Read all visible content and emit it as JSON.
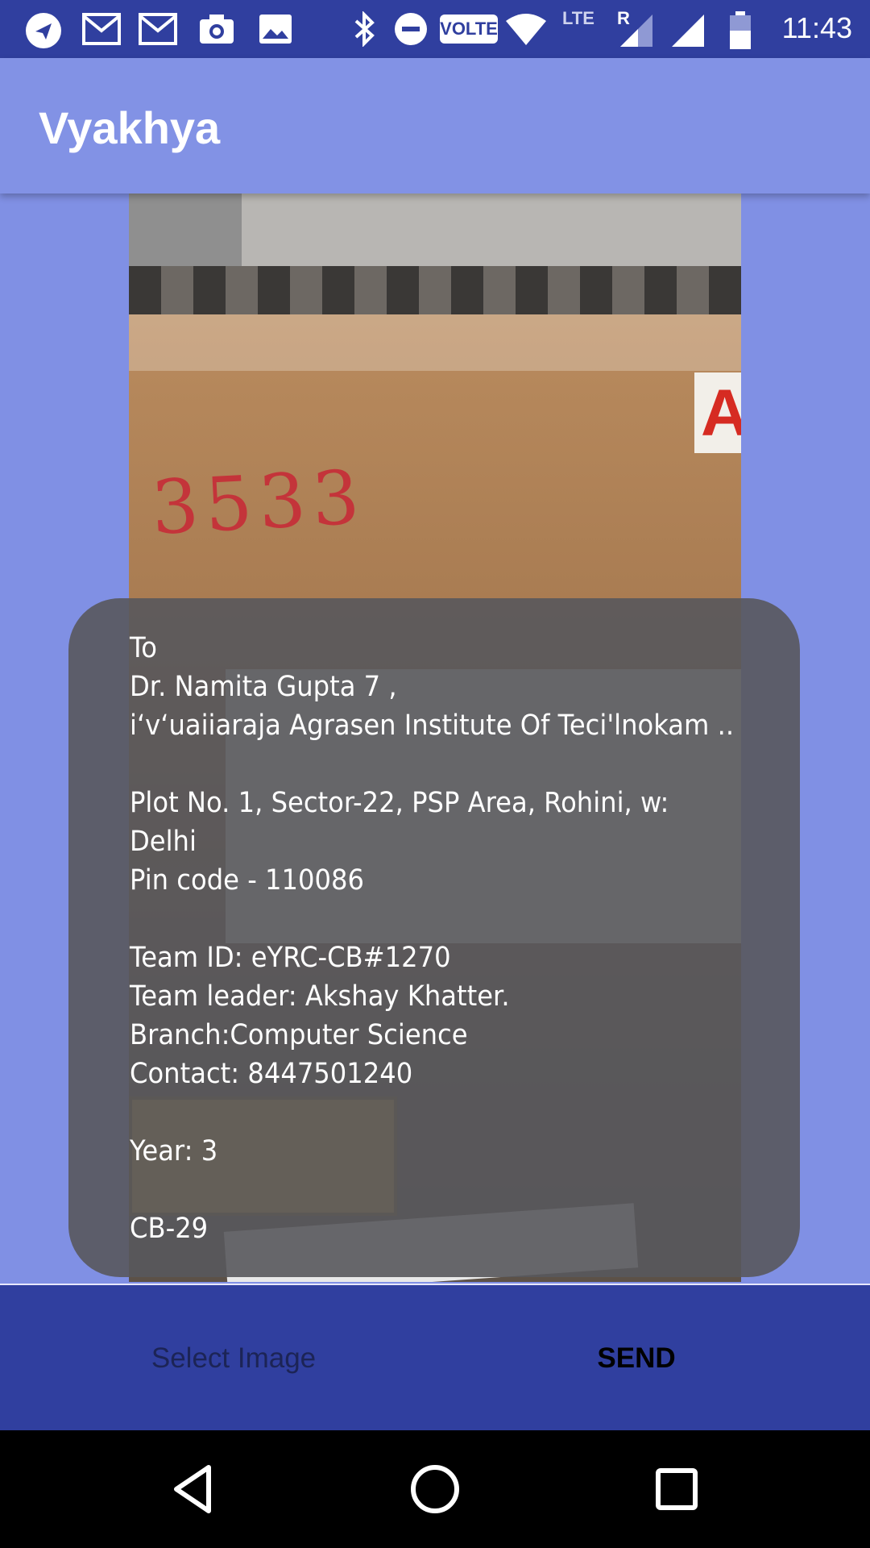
{
  "status_bar": {
    "time": "11:43",
    "volte_label": "VOLTE",
    "lte_label": "LTE",
    "roaming_label": "R",
    "icons": [
      "telegram-icon",
      "gmail-icon",
      "gmail-icon",
      "camera-icon",
      "image-icon",
      "bluetooth-icon",
      "do-not-disturb-icon",
      "volte-icon",
      "wifi-icon",
      "lte-signal-icon",
      "cell-signal-icon",
      "battery-icon"
    ]
  },
  "app_bar": {
    "title": "Vyakhya"
  },
  "ocr_result": {
    "text": "To\nDr. Namita Gupta 7 ,\ni‘v‘uaiiaraja Agrasen Institute Of Teci'lnokam ..\n\nPlot No. 1, Sector-22, PSP Area, Rohini, w:\nDelhi\nPin code - 110086\n\nTeam ID: eYRC-CB#1270\nTeam leader: Akshay Khatter.\nBranch:Computer Science\nContact: 8447501240\n\nYear: 3\n\nCB-29"
  },
  "actions": {
    "select_image_label": "Select Image",
    "send_label": "SEND"
  },
  "nav_bar": {
    "icons": [
      "back-icon",
      "home-icon",
      "recents-icon"
    ]
  },
  "colors": {
    "status_bar": "#303f9f",
    "app_bar": "#8292e5",
    "background": "#8090e4",
    "bottom_bar": "#303f9f"
  }
}
